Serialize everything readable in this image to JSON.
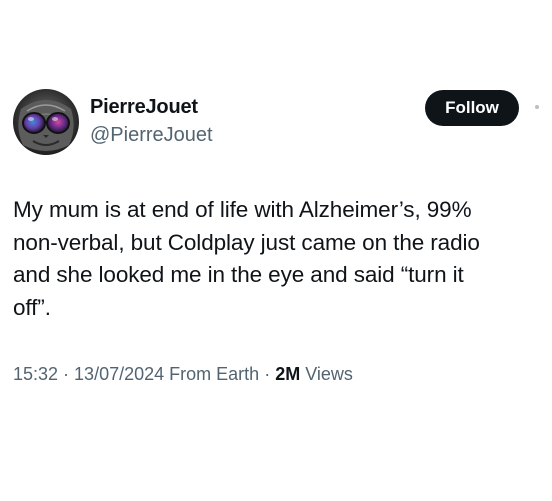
{
  "author": {
    "display_name": "PierreJouet",
    "handle": "@PierreJouet",
    "avatar_icon": "cat-with-sunglasses-avatar"
  },
  "follow_button": {
    "label": "Follow"
  },
  "tweet": {
    "text_lines": [
      "My mum is at end of life with Alzheimer’s, 99%",
      "non-verbal, but Coldplay just came on the radio",
      "and she looked me in the eye and said “turn it",
      "off”."
    ]
  },
  "meta": {
    "time": "15:32",
    "separator": " · ",
    "date": "13/07/2024",
    "source": "From Earth",
    "views_count": "2M",
    "views_label": "Views"
  },
  "colors": {
    "text_primary": "#0f1419",
    "text_secondary": "#536471",
    "button_bg": "#0f1419",
    "button_text": "#ffffff"
  }
}
